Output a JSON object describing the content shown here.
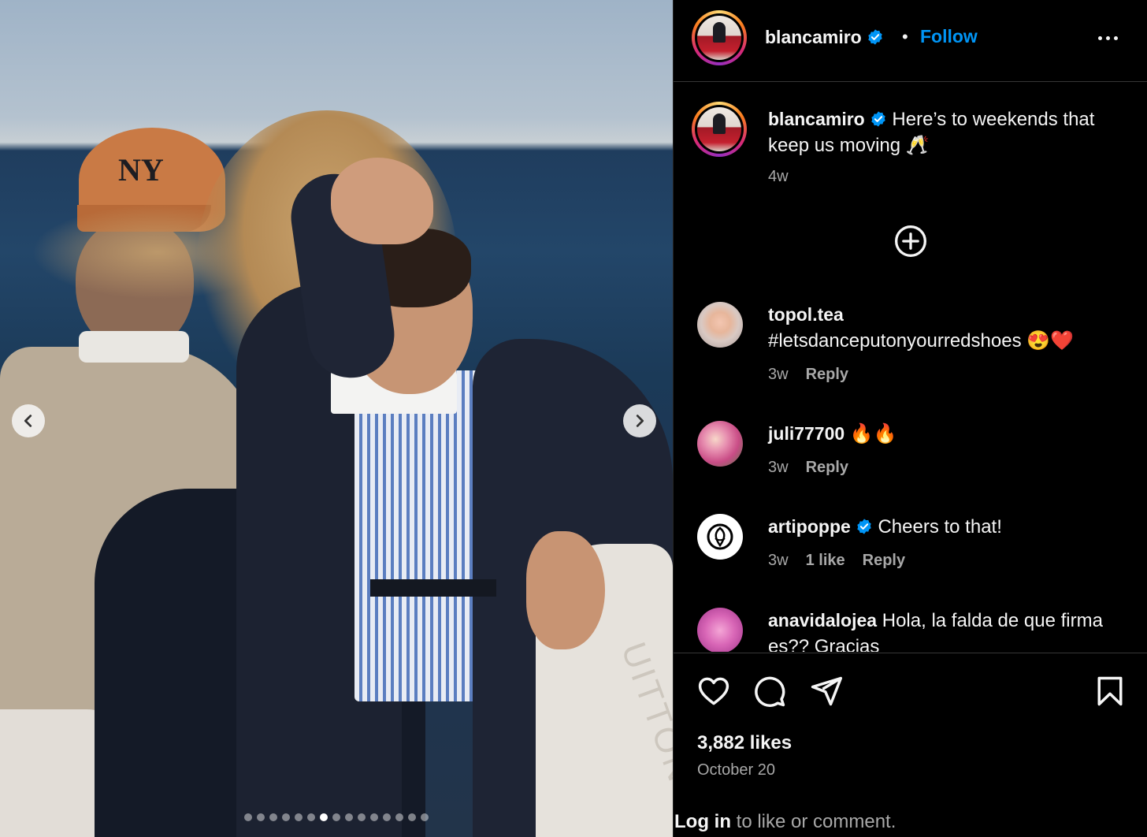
{
  "post": {
    "username": "blancamiro",
    "follow_label": "Follow",
    "separator": "•",
    "caption": "Here’s to weekends that keep us moving 🥂",
    "caption_time": "4w",
    "cap_logo_text": "NY",
    "cushion_text": "UITTON",
    "carousel": {
      "total_slides": 15,
      "current_slide": 7
    }
  },
  "comments": [
    {
      "username": "topol.tea",
      "verified": false,
      "text": "#letsdanceputonyourredshoes 😍❤️",
      "time": "3w",
      "likes": "",
      "reply": "Reply"
    },
    {
      "username": "juli77700",
      "verified": false,
      "text": "🔥🔥",
      "time": "3w",
      "likes": "",
      "reply": "Reply"
    },
    {
      "username": "artipoppe",
      "verified": true,
      "text": "Cheers to that!",
      "time": "3w",
      "likes": "1 like",
      "reply": "Reply"
    },
    {
      "username": "anavidalojea",
      "verified": false,
      "text": "Hola, la falda de que firma es?? Gracias",
      "time": "",
      "likes": "",
      "reply": ""
    }
  ],
  "actions": {
    "likes_count": "3,882 likes",
    "date": "October 20",
    "login_link": "Log in",
    "login_rest": " to like or comment."
  },
  "icons": {
    "verified": "verified-badge-icon",
    "more": "more-options-icon",
    "add": "plus-circle-icon",
    "like": "heart-icon",
    "comment": "comment-bubble-icon",
    "share": "paper-plane-icon",
    "save": "bookmark-icon",
    "prev": "chevron-left-icon",
    "next": "chevron-right-icon"
  },
  "colors": {
    "accent": "#0095f6",
    "background": "#000000",
    "text_primary": "#f5f5f5",
    "text_secondary": "#a8a8a8"
  }
}
